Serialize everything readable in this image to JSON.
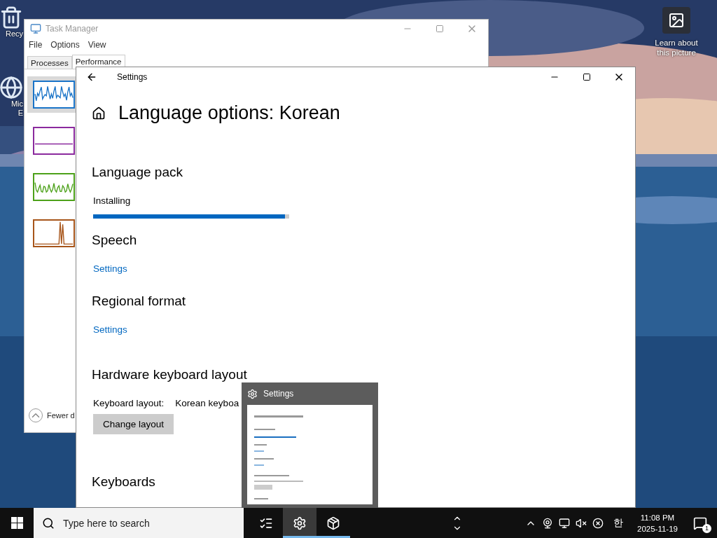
{
  "desktop": {
    "icons": [
      {
        "kind": "bin",
        "lines": [
          "Recy"
        ]
      },
      {
        "kind": "edge",
        "lines": [
          "Mic",
          "E"
        ]
      }
    ],
    "spotlight": {
      "label": "Learn about this picture"
    }
  },
  "task_manager": {
    "title": "Task Manager",
    "menu": [
      "File",
      "Options",
      "View"
    ],
    "tabs": [
      {
        "label": "Processes",
        "selected": false
      },
      {
        "label": "Performance",
        "selected": true
      }
    ],
    "graphs": [
      {
        "color": "#1a74c8",
        "selected": true
      },
      {
        "color": "#8b2a9e",
        "selected": false
      },
      {
        "color": "#4da11a",
        "selected": false
      },
      {
        "color": "#a7551a",
        "selected": false
      }
    ],
    "footer": "Fewer d"
  },
  "settings": {
    "title": "Settings",
    "heading": "Language options: Korean",
    "sections": [
      {
        "kind": "progress",
        "title": "Language pack",
        "status": "Installing",
        "level": 0.98
      },
      {
        "kind": "link",
        "title": "Speech",
        "link": "Settings"
      },
      {
        "kind": "link",
        "title": "Regional format",
        "link": "Settings"
      },
      {
        "kind": "keyboard",
        "title": "Hardware keyboard layout",
        "label": "Keyboard layout:",
        "value": "Korean keyboa",
        "button": "Change layout"
      },
      {
        "kind": "heading",
        "title": "Keyboards"
      }
    ]
  },
  "thumbnail": {
    "title": "Settings"
  },
  "taskbar": {
    "search": {
      "placeholder": "Type here to search"
    },
    "apps": [
      {
        "kind": "taskview",
        "selected": false,
        "running": false
      },
      {
        "kind": "settings",
        "selected": true,
        "running": true
      },
      {
        "kind": "box",
        "selected": false,
        "running": true
      }
    ],
    "tray": {
      "ime": "한",
      "time": "11:08 PM",
      "date": "2025-11-19",
      "notifications": "1"
    }
  }
}
